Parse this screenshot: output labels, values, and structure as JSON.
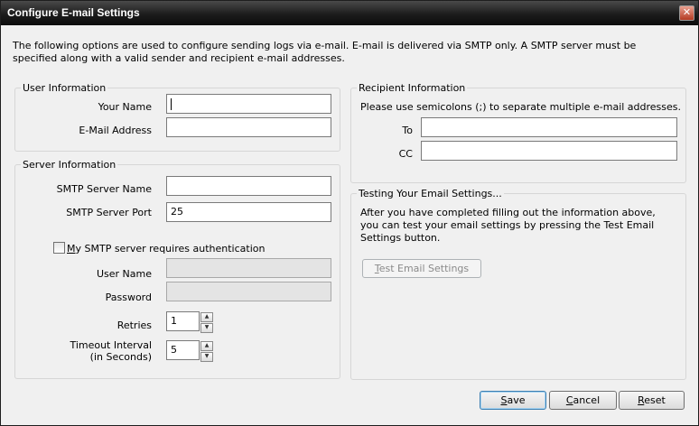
{
  "window": {
    "title": "Configure E-mail Settings",
    "close_glyph": "✕",
    "intro": "The following options are used to configure sending logs via e-mail.  E-mail is delivered via SMTP only.  A SMTP server must be specified along with a valid sender and recipient e-mail addresses."
  },
  "user_info": {
    "legend": "User Information",
    "name_label": "Your Name",
    "name_value": "",
    "email_label": "E-Mail Address",
    "email_value": ""
  },
  "server_info": {
    "legend": "Server Information",
    "smtp_name_label": "SMTP Server Name",
    "smtp_name_value": "",
    "smtp_port_label": "SMTP Server Port",
    "smtp_port_value": "25",
    "auth_checkbox_first": "M",
    "auth_checkbox_rest": "y SMTP server requires authentication",
    "auth_checked": false,
    "username_label": "User Name",
    "password_label": "Password",
    "retries_label": "Retries",
    "retries_value": "1",
    "timeout_label_line1": "Timeout Interval",
    "timeout_label_line2": "(in Seconds)",
    "timeout_value": "5"
  },
  "recipient_info": {
    "legend": "Recipient Information",
    "hint": "Please use semicolons (;) to separate multiple e-mail addresses.",
    "to_label": "To",
    "to_value": "",
    "cc_label": "CC",
    "cc_value": ""
  },
  "testing": {
    "legend": "Testing Your Email Settings...",
    "description": "After you have completed filling out the information above, you can test your email settings by pressing the Test Email Settings button.",
    "test_button_first": "T",
    "test_button_rest": "est Email Settings"
  },
  "footer": {
    "save_first": "S",
    "save_rest": "ave",
    "cancel_first": "C",
    "cancel_rest": "ancel",
    "reset_first": "R",
    "reset_rest": "eset"
  },
  "icons": {
    "spin_up": "▲",
    "spin_down": "▼"
  }
}
